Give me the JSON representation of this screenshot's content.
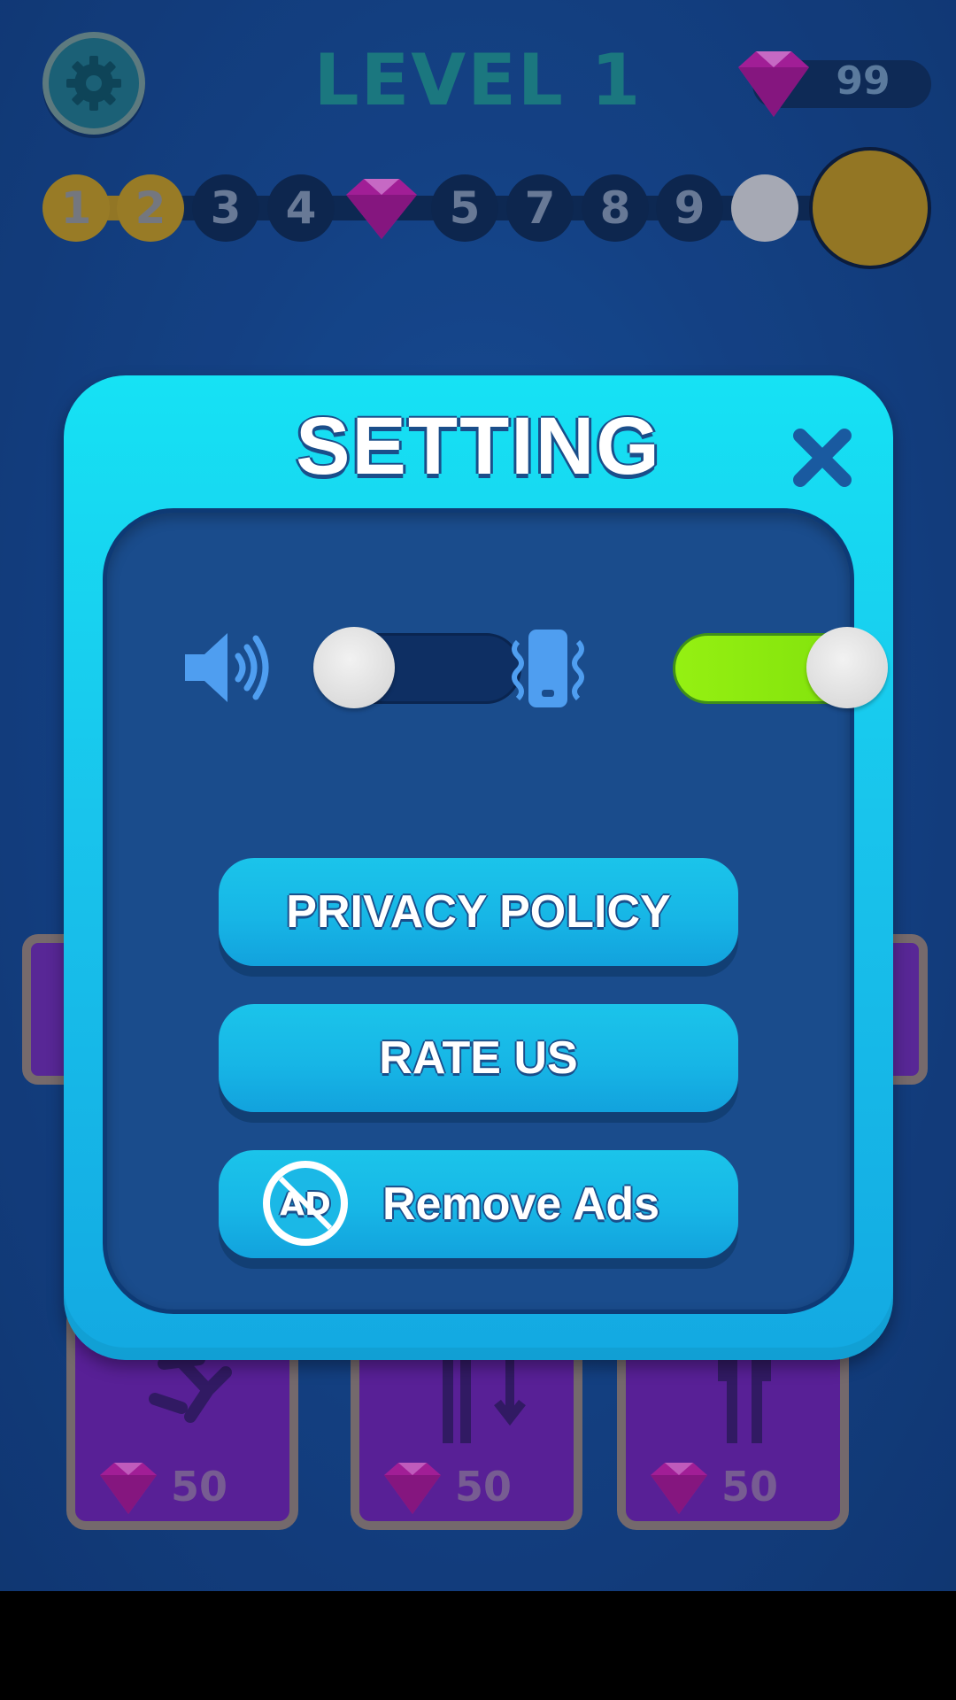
{
  "hud": {
    "level_title": "LEVEL 1",
    "gem_count": "99",
    "progress_nodes": [
      "1",
      "2",
      "3",
      "4",
      "5",
      "7",
      "8",
      "9"
    ]
  },
  "settings_dialog": {
    "title": "SETTING",
    "sound_on": false,
    "vibration_on": true,
    "buttons": {
      "privacy": "PRIVACY POLICY",
      "rate": "RATE US",
      "remove_ads": "Remove Ads"
    },
    "ad_icon_text": "AD"
  },
  "shop": {
    "prices": [
      "50",
      "50",
      "50"
    ]
  },
  "colors": {
    "background": "#164a92",
    "dialog": "#16c0ec",
    "panel": "#1a4c8c",
    "toggle_on": "#8ee70f",
    "gold": "#b8911f",
    "gem": "#c21fa8"
  },
  "icons": [
    "gear-icon",
    "gem-icon",
    "close-icon",
    "speaker-icon",
    "vibration-icon",
    "no-ads-icon"
  ]
}
